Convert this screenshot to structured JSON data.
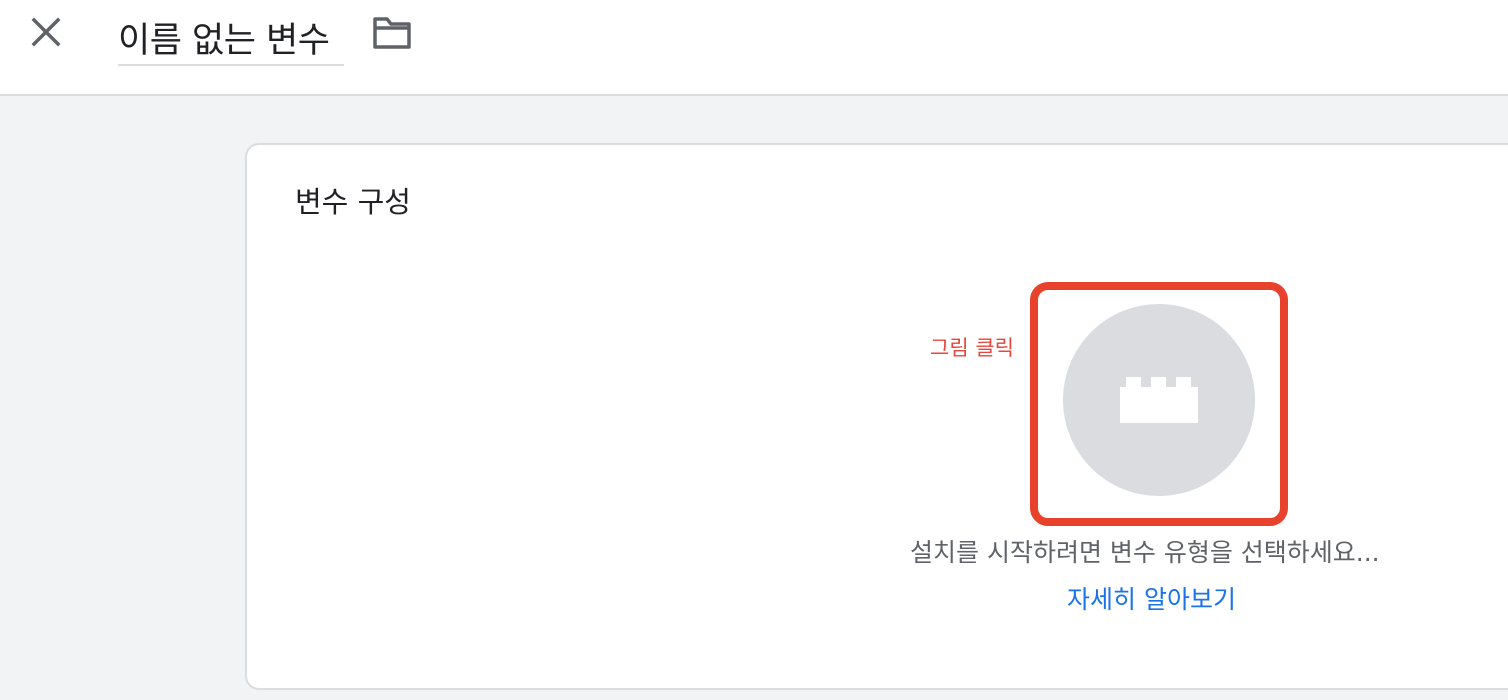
{
  "header": {
    "close_icon": "close-icon",
    "title": "이름 없는 변수",
    "folder_icon": "folder-icon"
  },
  "card": {
    "title": "변수 구성",
    "annotation": "그림 클릭",
    "type_icon": "lego-brick-icon",
    "hint": "설치를 시작하려면 변수 유형을 선택하세요...",
    "learn_more": "자세히 알아보기"
  },
  "colors": {
    "annotation": "#e8453c",
    "highlight_box": "#e8412c",
    "link": "#1a73e8",
    "circle": "#dadce0",
    "background": "#f1f3f4"
  }
}
